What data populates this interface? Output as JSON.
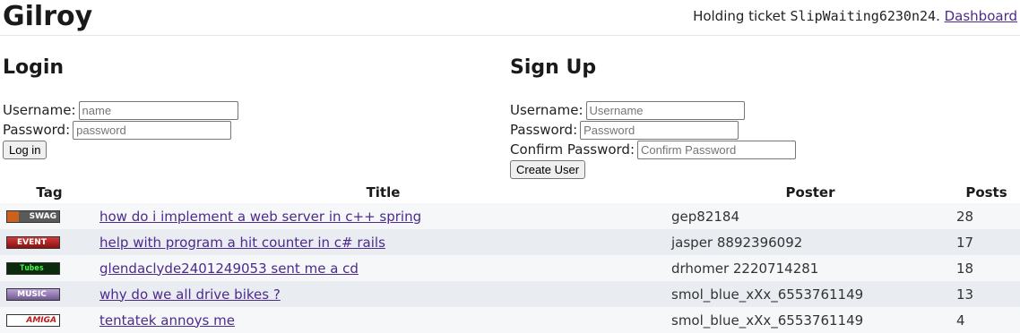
{
  "site": {
    "title": "Gilroy"
  },
  "ticket": {
    "prefix": "Holding ticket ",
    "code": "SlipWaiting6230n24",
    "suffix": ". ",
    "dashboard_link": "Dashboard"
  },
  "login": {
    "heading": "Login",
    "username_label": "Username:",
    "username_placeholder": "name",
    "password_label": "Password:",
    "password_placeholder": "password",
    "submit_label": "Log in"
  },
  "signup": {
    "heading": "Sign Up",
    "username_label": "Username:",
    "username_placeholder": "Username",
    "password_label": "Password:",
    "password_placeholder": "Password",
    "confirm_label": "Confirm Password:",
    "confirm_placeholder": "Confirm Password",
    "submit_label": "Create User"
  },
  "threads": {
    "headers": {
      "tag": "Tag",
      "title": "Title",
      "poster": "Poster",
      "posts": "Posts"
    },
    "rows": [
      {
        "tag": "SWAG",
        "tag_icon": "swag-tag-icon",
        "title": "how do i implement a web server in c++ spring",
        "poster": "gep82184",
        "posts": "28"
      },
      {
        "tag": "EVENT",
        "tag_icon": "event-tag-icon",
        "title": "help with program a hit counter in c# rails",
        "poster": "jasper 8892396092",
        "posts": "17"
      },
      {
        "tag": "Tubes",
        "tag_icon": "tubes-tag-icon",
        "title": "glendaclyde2401249053 sent me a cd",
        "poster": "drhomer 2220714281",
        "posts": "18"
      },
      {
        "tag": "MUSIC",
        "tag_icon": "music-tag-icon",
        "title": "why do we all drive bikes ?",
        "poster": "smol_blue_xXx_6553761149",
        "posts": "13"
      },
      {
        "tag": "AMIGA",
        "tag_icon": "amiga-tag-icon",
        "title": "tentatek annoys me",
        "poster": "smol_blue_xXx_6553761149",
        "posts": "4"
      }
    ]
  }
}
